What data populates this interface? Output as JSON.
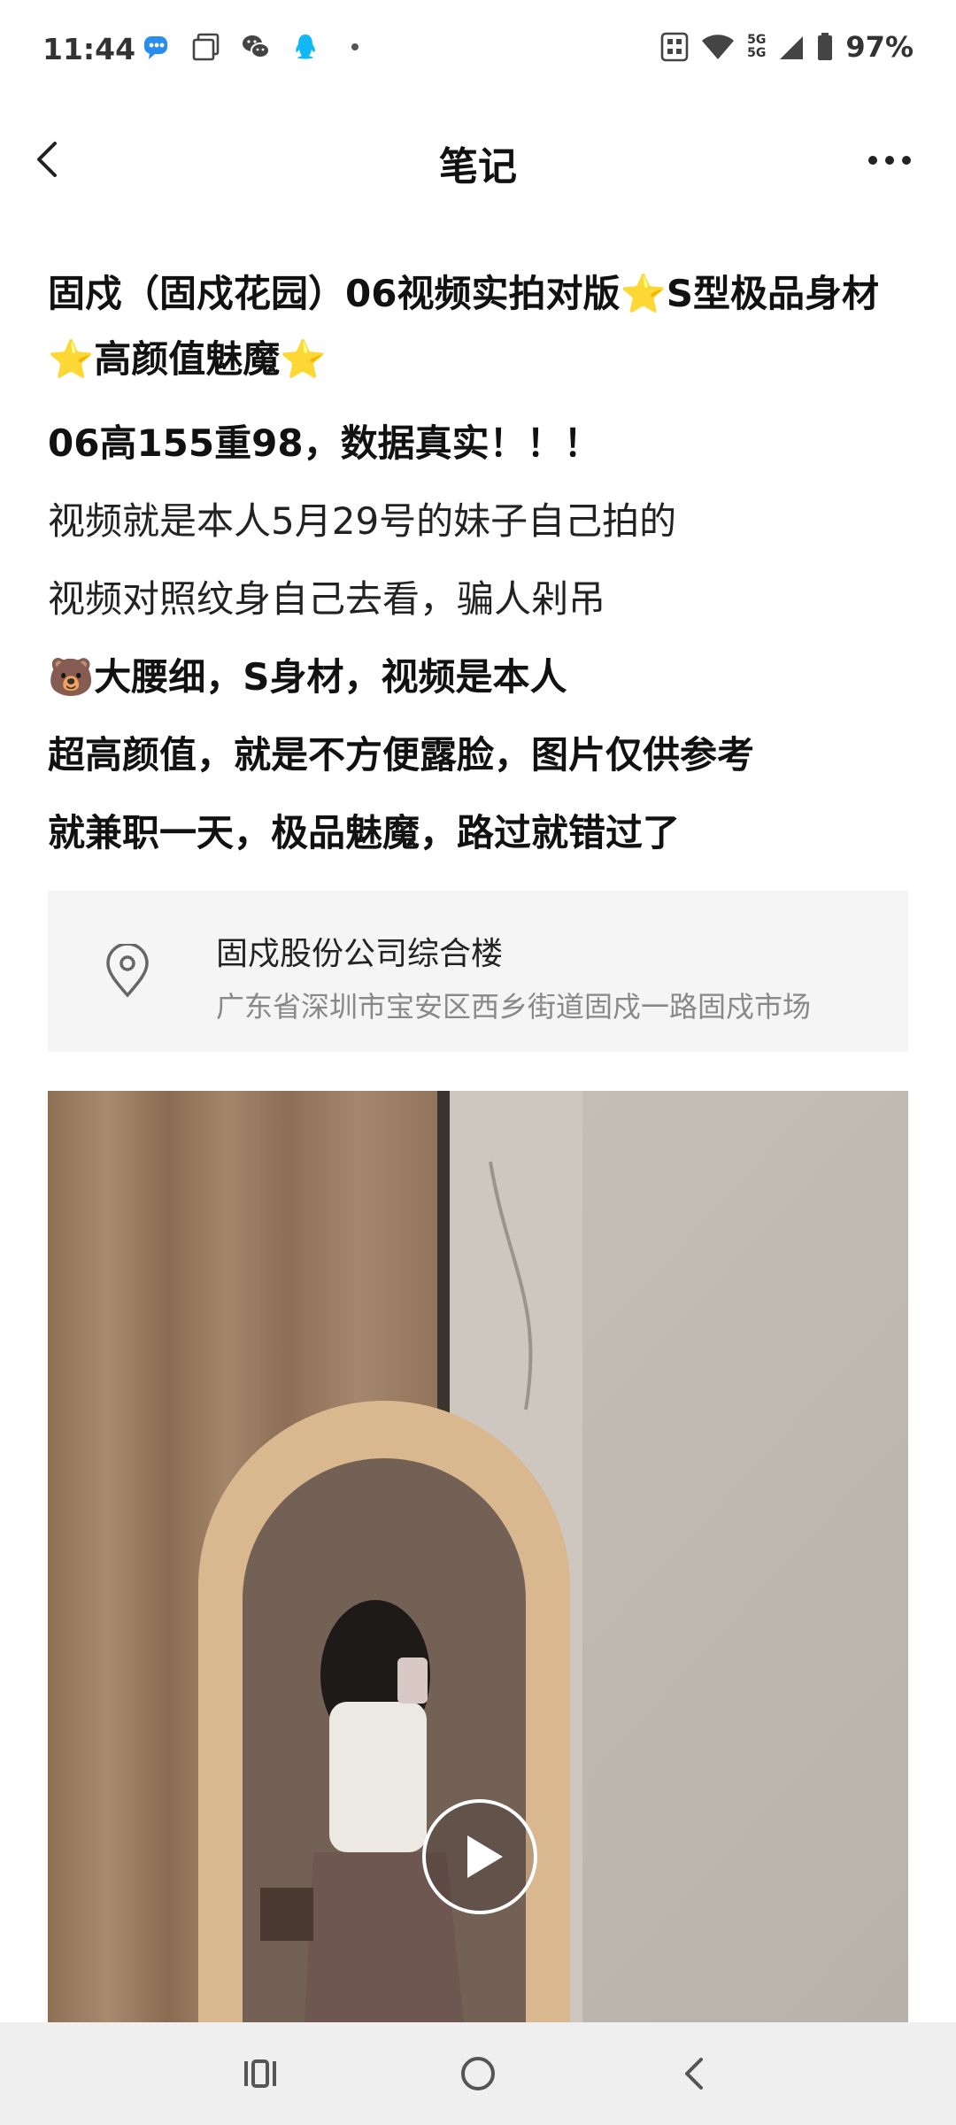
{
  "status_bar": {
    "time": "11:44",
    "network_top": "5G",
    "network_bottom": "5G",
    "battery": "97%",
    "icons_left": [
      "chat-bubble-icon",
      "gallery-icon",
      "wechat-icon",
      "qq-icon",
      "dot-icon"
    ],
    "icons_right": [
      "nfc-icon",
      "wifi-icon",
      "signal-icon",
      "battery-icon"
    ]
  },
  "header": {
    "title": "笔记"
  },
  "post": {
    "title": "固戍（固戍花园）06视频实拍对版⭐S型极品身材⭐高颜值魅魔⭐",
    "lines": [
      "06高155重98，数据真实！！！",
      "视频就是本人5月29号的妹子自己拍的",
      "视频对照纹身自己去看，骗人剁吊",
      "🐻大腰细，S身材，视频是本人",
      "超高颜值，就是不方便露脸，图片仅供参考",
      "就兼职一天，极品魅魔，路过就错过了"
    ]
  },
  "location": {
    "name": "固戍股份公司综合楼",
    "address": "广东省深圳市宝安区西乡街道固戍一路固戍市场"
  },
  "media": {
    "type": "video",
    "play_icon": "play-icon"
  },
  "nav_bar": {
    "buttons": [
      "recent-apps-icon",
      "home-icon",
      "back-nav-icon"
    ]
  }
}
